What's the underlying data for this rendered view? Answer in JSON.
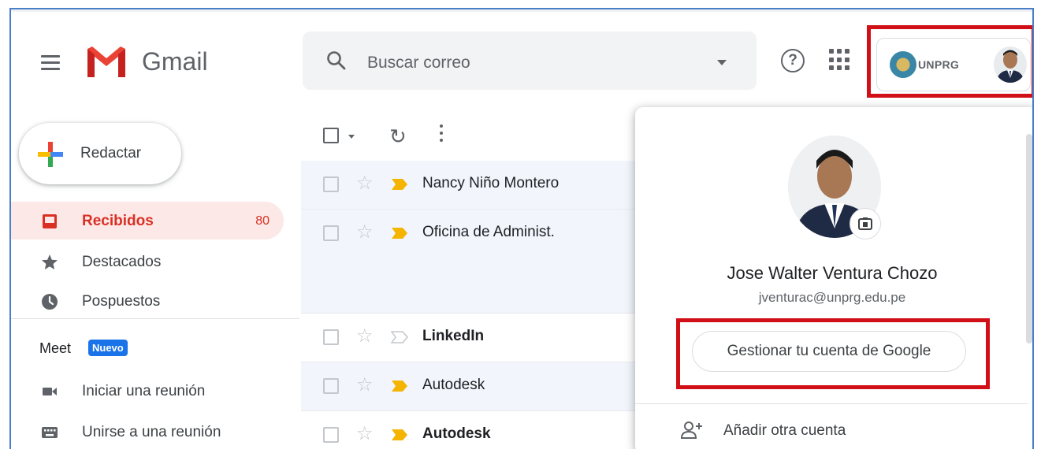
{
  "app": {
    "name": "Gmail"
  },
  "search": {
    "placeholder": "Buscar correo"
  },
  "header": {
    "org_label": "UNPRG"
  },
  "compose": {
    "label": "Redactar"
  },
  "sidebar": {
    "items": [
      {
        "label": "Recibidos",
        "count": "80",
        "active": true
      },
      {
        "label": "Destacados"
      },
      {
        "label": "Pospuestos"
      }
    ]
  },
  "meet": {
    "title": "Meet",
    "badge": "Nuevo",
    "items": [
      {
        "label": "Iniciar una reunión"
      },
      {
        "label": "Unirse a una reunión"
      }
    ]
  },
  "mail_list": {
    "rows": [
      {
        "sender": "Nancy Niño Montero",
        "important": true,
        "unread": false
      },
      {
        "sender": "Oficina de Administ.",
        "important": true,
        "unread": false
      },
      {
        "sender": "LinkedIn",
        "important": false,
        "unread": true
      },
      {
        "sender": "Autodesk",
        "important": true,
        "unread": false
      },
      {
        "sender": "Autodesk",
        "important": true,
        "unread": true
      }
    ]
  },
  "account_popup": {
    "name": "Jose Walter Ventura Chozo",
    "email": "jventurac@unprg.edu.pe",
    "manage_label": "Gestionar tu cuenta de Google",
    "add_account_label": "Añadir otra cuenta"
  },
  "colors": {
    "highlight_box": "#d10f17",
    "active_nav_bg": "#fce8e6",
    "active_nav_text": "#d93025",
    "badge_bg": "#1a73e8",
    "important_marker": "#f4b400",
    "frame_border": "#4a7fc7"
  },
  "icons": {
    "menu": "hamburger-icon",
    "search": "search-icon",
    "help": "help-icon",
    "apps": "apps-grid-icon",
    "compose": "plus-icon",
    "inbox": "inbox-icon",
    "starred": "star-icon",
    "snoozed": "clock-icon",
    "meet_start": "video-camera-icon",
    "meet_join": "keyboard-icon",
    "camera": "camera-icon",
    "add_account": "person-add-icon"
  }
}
